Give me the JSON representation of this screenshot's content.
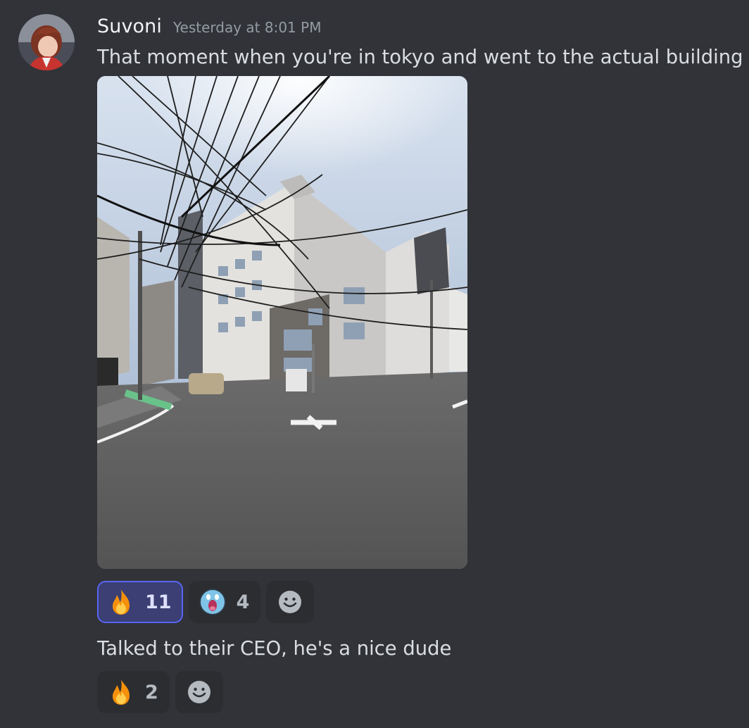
{
  "message": {
    "author": "Suvoni",
    "timestamp": "Yesterday at 8:01 PM",
    "lines": [
      "That moment when you're in tokyo and went to the actual building",
      "Talked to their CEO, he's a nice dude"
    ],
    "attachment_icon": "photo-of-building-at-street-corner"
  },
  "reactions_1": [
    {
      "emoji": "fire",
      "count": "11",
      "selected": true
    },
    {
      "emoji": "surprised-face",
      "count": "4",
      "selected": false
    }
  ],
  "reactions_2": [
    {
      "emoji": "fire",
      "count": "2",
      "selected": false
    }
  ],
  "icons": {
    "add_reaction": "smiley-add-reaction-icon"
  },
  "colors": {
    "background": "#313338",
    "reaction_bg": "#2b2d31",
    "reaction_selected_bg": "#3b3f73",
    "reaction_selected_border": "#5865f2",
    "timestamp": "#949ba4"
  }
}
